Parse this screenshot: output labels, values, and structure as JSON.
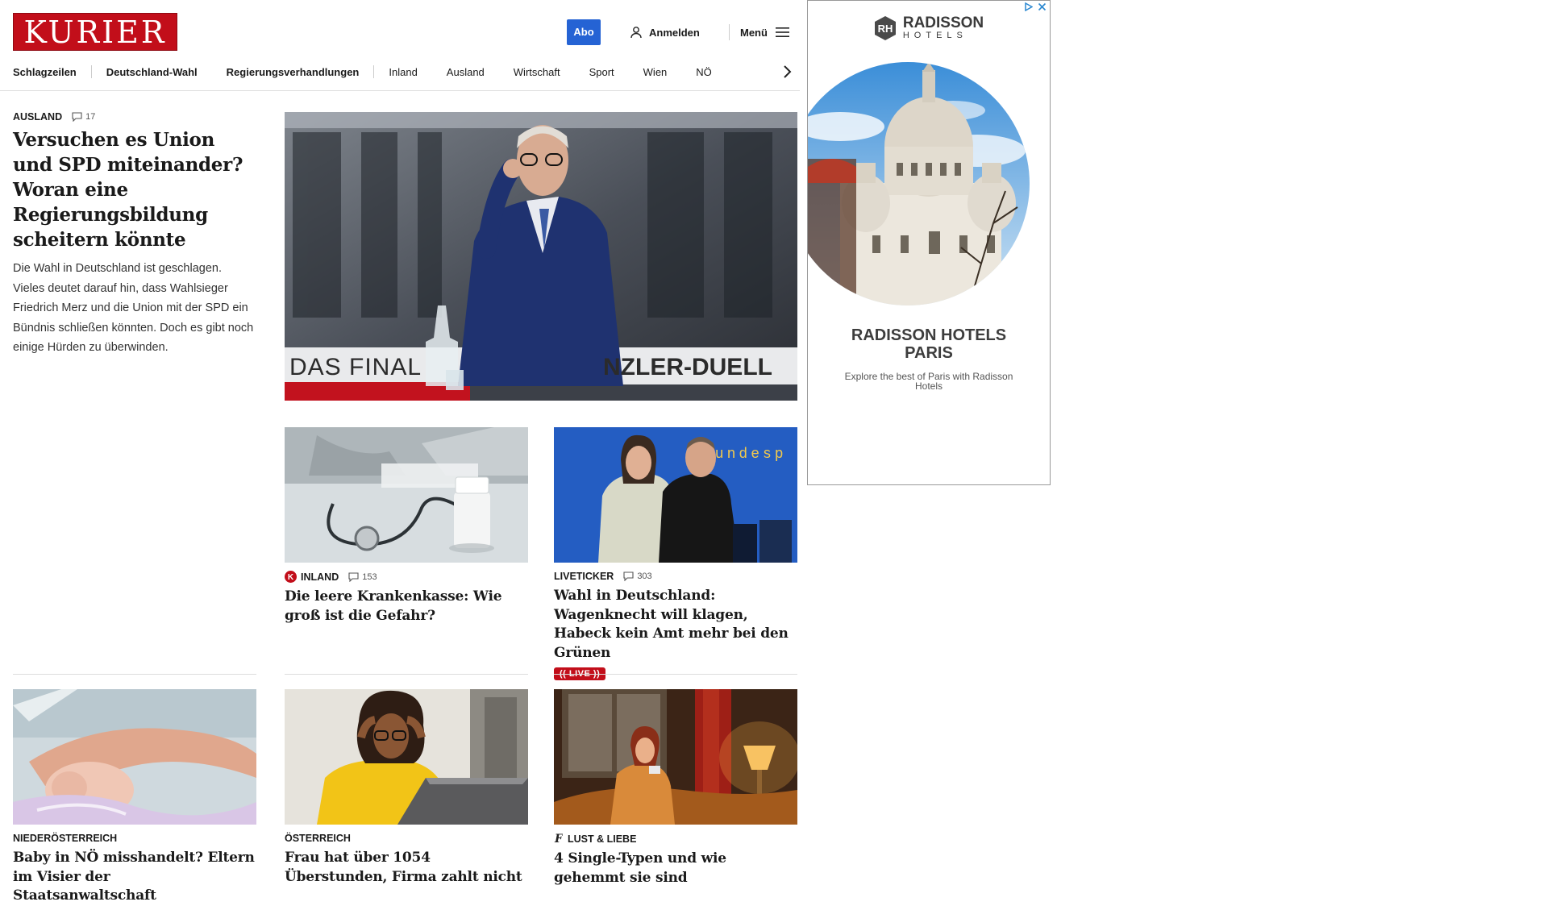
{
  "header": {
    "logo": "KURIER",
    "abo_label": "Abo",
    "login_label": "Anmelden",
    "menu_label": "Menü"
  },
  "nav": {
    "items": [
      "Schlagzeilen",
      "Deutschland-Wahl",
      "Regierungsverhandlungen",
      "Inland",
      "Ausland",
      "Wirtschaft",
      "Sport",
      "Wien",
      "NÖ"
    ]
  },
  "lead": {
    "kicker": "AUSLAND",
    "comments": "17",
    "title": "Versuchen es Union und SPD miteinander? Woran eine Regierungsbildung scheitern könnte",
    "teaser": "Die Wahl in Deutschland ist geschlagen. Vieles deutet darauf hin, dass Wahlsieger Friedrich Merz und die Union mit der SPD ein Bündnis schließen könnten. Doch es gibt noch einige Hürden zu überwinden.",
    "image_caption_left": "DAS FINAL",
    "image_caption_right": "NZLER-DUELL"
  },
  "cards": [
    {
      "kicker": "INLAND",
      "comments": "153",
      "title": "Die leere Krankenkasse: Wie groß ist die Gefahr?"
    },
    {
      "kicker": "LIVETICKER",
      "comments": "303",
      "title": "Wahl in Deutschland: Wagenknecht will klagen, Habeck kein Amt mehr bei den Grünen",
      "badge": "LIVE",
      "image_sign": "Bundesp"
    },
    {
      "kicker": "NIEDERÖSTERREICH",
      "title": "Baby in NÖ misshandelt? Eltern im Visier der Staatsanwaltschaft"
    },
    {
      "kicker": "ÖSTERREICH",
      "title": "Frau hat über 1054 Überstunden, Firma zahlt nicht"
    },
    {
      "kicker": "LUST & LIEBE",
      "title": "4 Single-Typen und wie gehemmt sie sind"
    }
  ],
  "ad": {
    "brand": "RADISSON",
    "brand_sub": "HOTELS",
    "headline_line1": "RADISSON HOTELS",
    "headline_line2": "PARIS",
    "copy": "Explore the best of Paris with Radisson Hotels"
  },
  "colors": {
    "brand_red": "#c20e1a",
    "abo_blue": "#2563d4"
  }
}
